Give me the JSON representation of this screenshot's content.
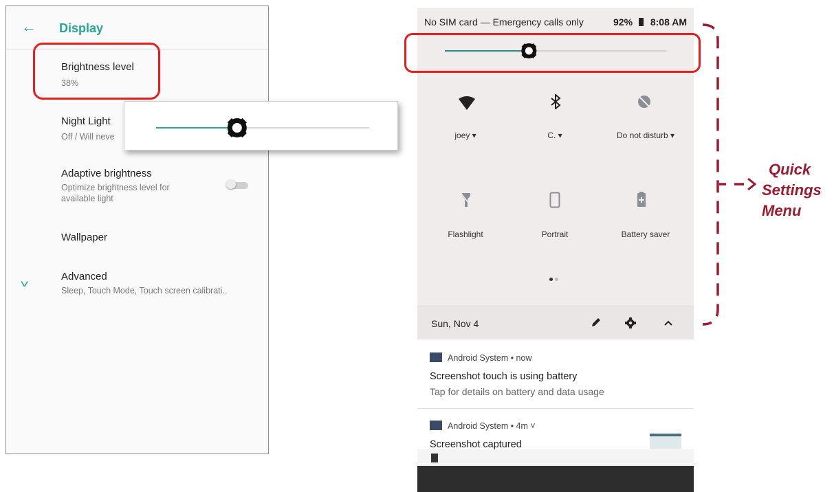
{
  "left_screen": {
    "header": {
      "title": "Display",
      "back_icon": "back-arrow-icon"
    },
    "preferences": [
      {
        "title": "Brightness level",
        "summary": "38%"
      },
      {
        "title": "Night Light",
        "summary": "Off / Will neve"
      },
      {
        "title": "Adaptive brightness",
        "summary_line1": "Optimize brightness level for",
        "summary_line2": "available light",
        "toggle_on": false
      },
      {
        "title": "Wallpaper"
      },
      {
        "title": "Advanced",
        "summary": "Sleep, Touch Mode, Touch screen calibrati.."
      }
    ],
    "brightness_popup": {
      "level": 0.38
    }
  },
  "right_screen": {
    "status_bar": {
      "left": "No SIM card — Emergency calls only",
      "battery": "92%",
      "time": "8:08 AM"
    },
    "brightness": {
      "level": 0.38
    },
    "tiles": [
      {
        "label": "joey",
        "icon": "wifi-icon",
        "has_dropdown": true
      },
      {
        "label": "C.",
        "icon": "bluetooth-icon",
        "has_dropdown": true
      },
      {
        "label": "Do not disturb",
        "icon": "do-not-disturb-icon",
        "has_dropdown": true
      },
      {
        "label": "Flashlight",
        "icon": "flashlight-icon"
      },
      {
        "label": "Portrait",
        "icon": "portrait-icon"
      },
      {
        "label": "Battery saver",
        "icon": "battery-saver-icon"
      }
    ],
    "page_dots": {
      "count": 2,
      "active": 0
    },
    "footer": {
      "date": "Sun, Nov 4",
      "icons": [
        "edit-icon",
        "settings-gear-icon",
        "collapse-chevron-icon"
      ]
    },
    "notifications": [
      {
        "app": "Android System • now",
        "title": "Screenshot touch is using battery",
        "text": "Tap for details on battery and data usage"
      },
      {
        "app": "Android System • 4m ˅",
        "title": "Screenshot captured"
      }
    ]
  },
  "annotation": {
    "line1": "Quick",
    "line2": "Settings",
    "line3": "Menu",
    "color": "#9b1b30"
  },
  "colors": {
    "accent": "#26a69a",
    "highlight": "#e81d1d"
  }
}
